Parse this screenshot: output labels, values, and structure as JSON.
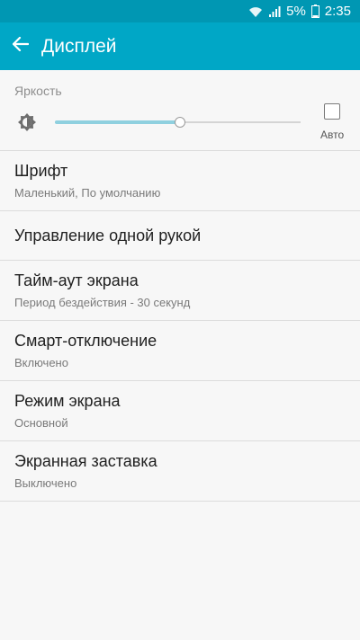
{
  "status_bar": {
    "battery_percent": "5%",
    "time": "2:35",
    "icons": [
      "wifi-icon",
      "signal-icon",
      "battery-icon"
    ]
  },
  "app_bar": {
    "title": "Дисплей",
    "back_icon": "arrow-left-icon"
  },
  "brightness": {
    "section_label": "Яркость",
    "level_fraction": 0.51,
    "auto_label": "Авто",
    "auto_checked": false,
    "icon": "brightness-sun-icon"
  },
  "items": [
    {
      "title": "Шрифт",
      "subtitle": "Маленький, По умолчанию"
    },
    {
      "title": "Управление одной рукой"
    },
    {
      "title": "Тайм-аут экрана",
      "subtitle": "Период бездействия - 30 секунд"
    },
    {
      "title": "Смарт-отключение",
      "subtitle": "Включено"
    },
    {
      "title": "Режим экрана",
      "subtitle": "Основной"
    },
    {
      "title": "Экранная заставка",
      "subtitle": "Выключено"
    }
  ],
  "colors": {
    "app_bar": "#00a7c6",
    "status_bar": "#0097b3",
    "slider_fill": "#8fd0df"
  }
}
